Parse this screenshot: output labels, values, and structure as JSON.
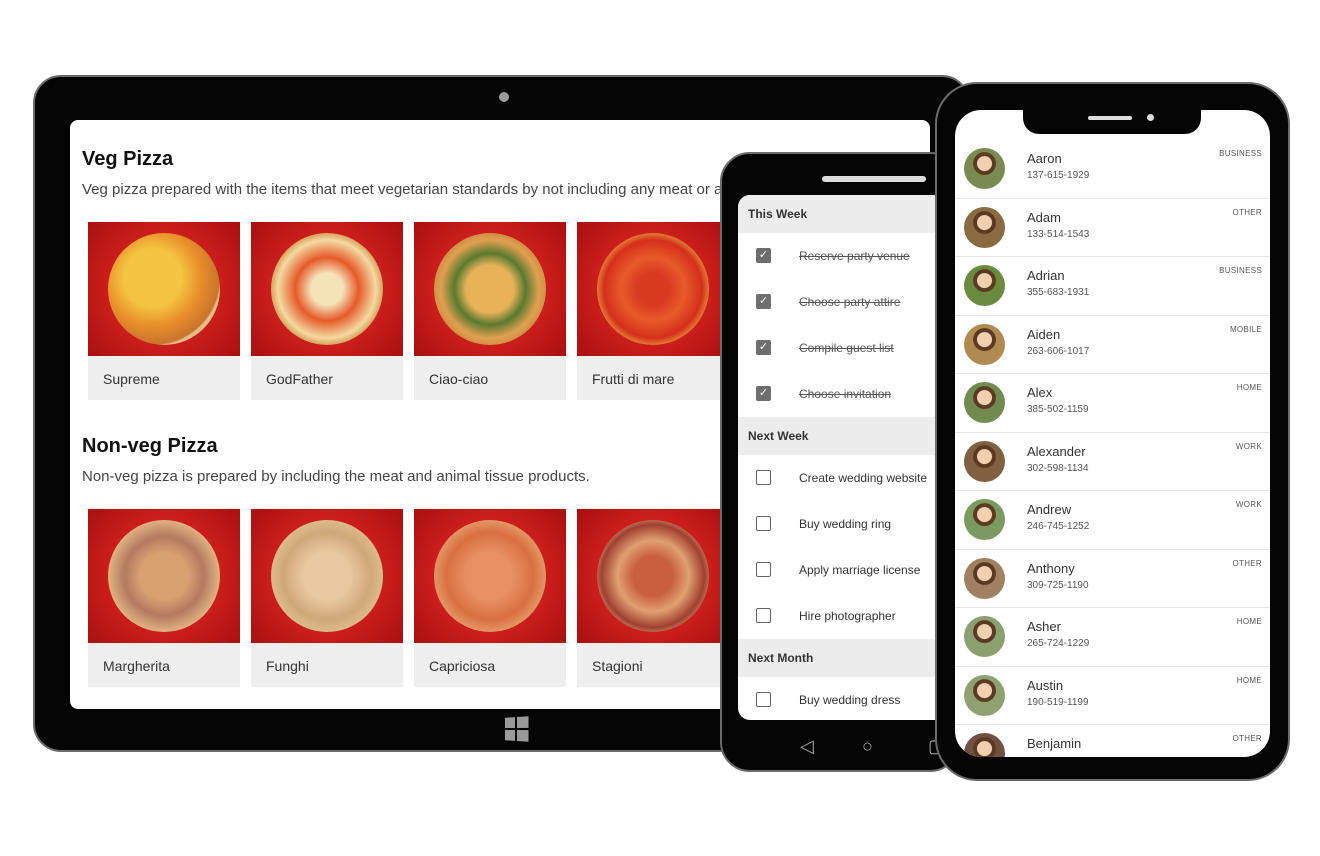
{
  "tablet": {
    "veg": {
      "title": "Veg Pizza",
      "description": "Veg pizza prepared with the items that meet vegetarian standards by not including any meat or animal tissue products.",
      "items": [
        {
          "name": "Supreme"
        },
        {
          "name": "GodFather"
        },
        {
          "name": "Ciao-ciao"
        },
        {
          "name": "Frutti di mare"
        }
      ]
    },
    "nonveg": {
      "title": "Non-veg Pizza",
      "description": "Non-veg pizza is prepared by including the meat and animal tissue products.",
      "items": [
        {
          "name": "Margherita"
        },
        {
          "name": "Funghi"
        },
        {
          "name": "Capriciosa"
        },
        {
          "name": "Stagioni"
        }
      ]
    }
  },
  "todo": {
    "groups": [
      {
        "title": "This Week",
        "tasks": [
          {
            "text": "Reserve party venue",
            "done": true
          },
          {
            "text": "Choose party attire",
            "done": true
          },
          {
            "text": "Compile guest list",
            "done": true
          },
          {
            "text": "Choose invitation",
            "done": true
          }
        ]
      },
      {
        "title": "Next Week",
        "tasks": [
          {
            "text": "Create wedding website",
            "done": false
          },
          {
            "text": "Buy wedding ring",
            "done": false
          },
          {
            "text": "Apply marriage license",
            "done": false
          },
          {
            "text": "Hire photographer",
            "done": false
          }
        ]
      },
      {
        "title": "Next Month",
        "tasks": [
          {
            "text": "Buy wedding dress",
            "done": false
          }
        ]
      }
    ]
  },
  "contacts": [
    {
      "name": "Aaron",
      "phone": "137-615-1929",
      "type": "BUSINESS"
    },
    {
      "name": "Adam",
      "phone": "133-514-1543",
      "type": "OTHER"
    },
    {
      "name": "Adrian",
      "phone": "355-683-1931",
      "type": "BUSINESS"
    },
    {
      "name": "Aiden",
      "phone": "263-606-1017",
      "type": "MOBILE"
    },
    {
      "name": "Alex",
      "phone": "385-502-1159",
      "type": "HOME"
    },
    {
      "name": "Alexander",
      "phone": "302-598-1134",
      "type": "WORK"
    },
    {
      "name": "Andrew",
      "phone": "246-745-1252",
      "type": "WORK"
    },
    {
      "name": "Anthony",
      "phone": "309-725-1190",
      "type": "OTHER"
    },
    {
      "name": "Asher",
      "phone": "265-724-1229",
      "type": "HOME"
    },
    {
      "name": "Austin",
      "phone": "190-519-1199",
      "type": "HOME"
    },
    {
      "name": "Benjamin",
      "phone": "",
      "type": "OTHER"
    }
  ]
}
